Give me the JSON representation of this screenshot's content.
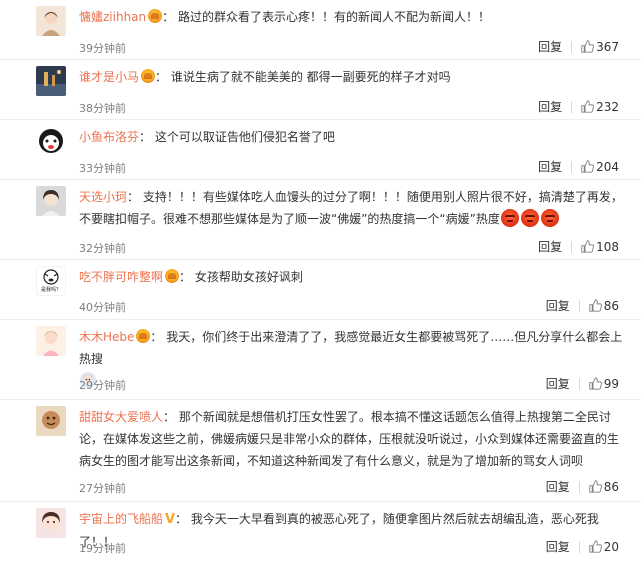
{
  "comments": [
    {
      "username": "慵嫿ziihhan",
      "badge": "heart-badge",
      "text": "：  路过的群众看了表示心疼！！有的新闻人不配为新闻人！！",
      "time": "39分钟前",
      "reply": "回复",
      "likes": "367"
    },
    {
      "username": "谁才是小马",
      "badge": "heart-badge",
      "text": "：  谁说生病了就不能美美的 都得一副要死的样子才对吗",
      "time": "38分钟前",
      "reply": "回复",
      "likes": "232"
    },
    {
      "username": "小鱼布洛芬",
      "badge": "",
      "text": "：  这个可以取证告他们侵犯名誉了吧",
      "time": "33分钟前",
      "reply": "回复",
      "likes": "204"
    },
    {
      "username": "天选小珂",
      "badge": "",
      "text": "：  支持！！！有些媒体吃人血馒头的过分了啊！！！随便用别人照片很不好，搞清楚了再发，不要瞎扣帽子。很难不想那些媒体是为了顺一波“佛媛”的热度搞一个“病媛”热度",
      "emoji_name": "angry-emoji",
      "emoji_count": 3,
      "time": "32分钟前",
      "reply": "回复",
      "likes": "108"
    },
    {
      "username": "吃不胖可咋整啊",
      "badge": "heart-badge",
      "text": "：  女孩帮助女孩好讽刺",
      "avatar_caption": "是我吗？",
      "time": "40分钟前",
      "reply": "回复",
      "likes": "86"
    },
    {
      "username": "木木Hebe",
      "badge": "heart-badge",
      "text": "：  我天，你们终于出来澄清了了，我感觉最近女生都要被骂死了……但凡分享什么都会上热搜",
      "time": "29分钟前",
      "reply": "回复",
      "likes": "99"
    },
    {
      "username": "甜甜女大爱喷人",
      "badge": "",
      "text": "：  那个新闻就是想借机打压女性罢了。根本搞不懂这话题怎么值得上热搜第二全民讨论，在媒体发这些之前，佛媛病媛只是非常小众的群体，压根就没听说过，小众到媒体还需要盗直的生病女生的图才能写出这条新闻，不知道这种新闻发了有什么意义，就是为了增加新的骂女人词呗",
      "time": "27分钟前",
      "reply": "回复",
      "likes": "86"
    },
    {
      "username": "宇宙上的飞船船",
      "badge": "v-badge",
      "text": "：  我今天一大早看到真的被恶心死了，随便拿图片然后就去胡编乱造，恶心死我了！！",
      "time": "19分钟前",
      "reply": "回复",
      "likes": "20"
    }
  ]
}
